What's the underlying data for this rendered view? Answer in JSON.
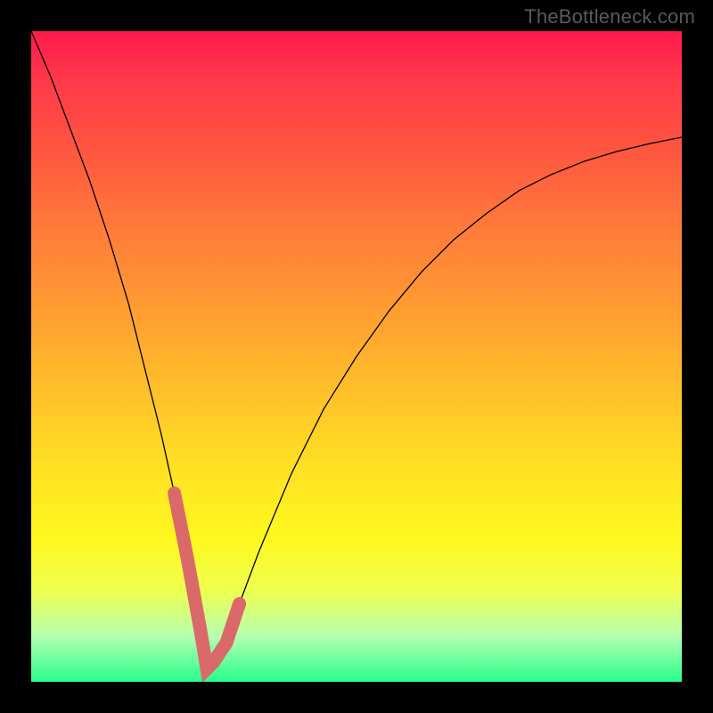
{
  "watermark": "TheBottleneck.com",
  "colors": {
    "frame": "#000000",
    "curve_thin": "#000000",
    "curve_thick": "#da6a6a"
  },
  "chart_data": {
    "type": "line",
    "title": "",
    "xlabel": "",
    "ylabel": "",
    "xlim": [
      0,
      100
    ],
    "ylim": [
      0,
      100
    ],
    "grid": false,
    "note": "V-shaped bottleneck curve; minimum ~x=27 y≈2. Thick salmon highlight on lowest segment.",
    "series": [
      {
        "name": "bottleneck-curve",
        "x": [
          0,
          3,
          6,
          9,
          12,
          15,
          18,
          20,
          22,
          24,
          26,
          27,
          28,
          30,
          32,
          35,
          40,
          45,
          50,
          55,
          60,
          65,
          70,
          75,
          80,
          85,
          90,
          95,
          100
        ],
        "y": [
          100,
          93,
          85,
          77,
          68,
          58,
          46,
          38,
          29,
          19,
          8,
          2,
          3,
          6,
          12,
          20,
          32,
          42,
          50,
          57,
          63,
          68,
          72,
          75.5,
          78,
          80,
          81.5,
          82.7,
          83.7
        ]
      },
      {
        "name": "highlight-segment",
        "x": [
          22,
          24,
          26,
          27,
          28,
          30,
          32
        ],
        "y": [
          29,
          19,
          8,
          2,
          3,
          6,
          12
        ]
      }
    ]
  }
}
